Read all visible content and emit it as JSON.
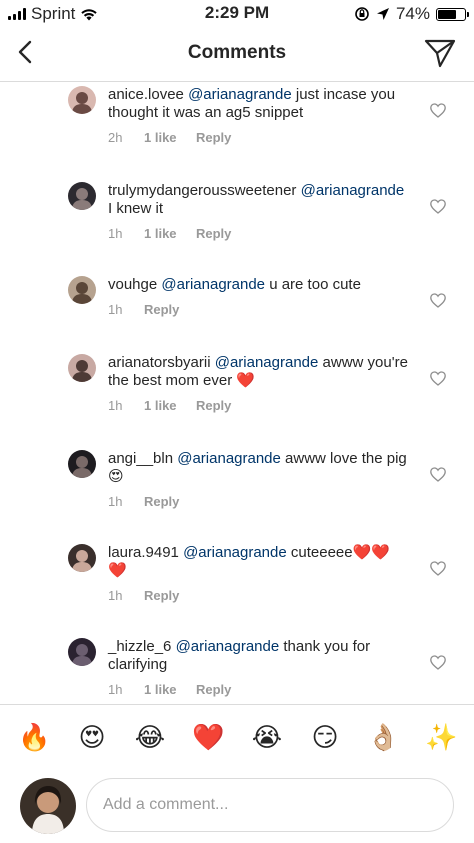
{
  "status_bar": {
    "carrier": "Sprint",
    "time": "2:29 PM",
    "battery": "74%",
    "battery_level": 0.74
  },
  "nav": {
    "title": "Comments"
  },
  "comments": [
    {
      "username": "anice.lovee",
      "mention": "@arianagrande",
      "text": " just incase you thought it was an ag5 snippet",
      "time": "2h",
      "likes": "1 like",
      "reply": "Reply"
    },
    {
      "username": "trulymydangeroussweetener",
      "mention": "@arianagrande",
      "text": " I knew it",
      "time": "1h",
      "likes": "1 like",
      "reply": "Reply"
    },
    {
      "username": "vouhge",
      "mention": "@arianagrande",
      "text": " u are too cute",
      "time": "1h",
      "likes": "",
      "reply": "Reply"
    },
    {
      "username": "arianatorsbyarii",
      "mention": "@arianagrande",
      "text": " awww you're the best mom ever ❤️",
      "time": "1h",
      "likes": "1 like",
      "reply": "Reply"
    },
    {
      "username": "angi__bln",
      "mention": "@arianagrande",
      "text": " awww love the pig😍",
      "time": "1h",
      "likes": "",
      "reply": "Reply"
    },
    {
      "username": "laura.9491",
      "mention": "@arianagrande",
      "text": " cuteeeee❤️❤️❤️",
      "time": "1h",
      "likes": "",
      "reply": "Reply"
    },
    {
      "username": "_hizzle_6",
      "mention": "@arianagrande",
      "text": " thank you for clarifying",
      "time": "1h",
      "likes": "1 like",
      "reply": "Reply"
    }
  ],
  "emoji_bar": [
    "🔥",
    "😍",
    "😂",
    "❤️",
    "😭",
    "😏",
    "👌🏼",
    "✨"
  ],
  "composer": {
    "placeholder": "Add a comment..."
  },
  "icons": {
    "back": "chevron-left-icon",
    "send": "paper-plane-icon",
    "like": "heart-outline-icon"
  },
  "colors": {
    "mention": "#003569",
    "meta": "#999999",
    "divider": "#dbdbdb"
  }
}
